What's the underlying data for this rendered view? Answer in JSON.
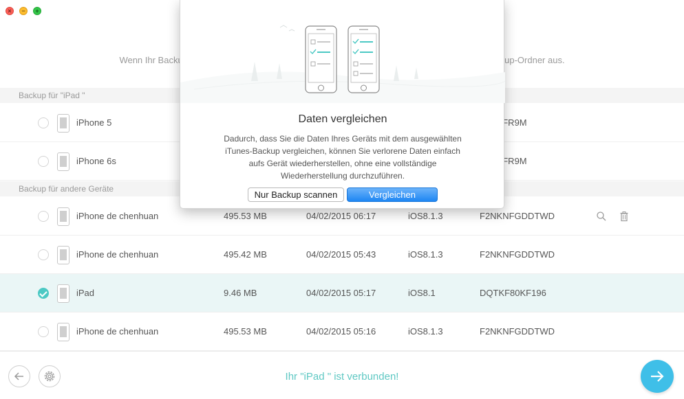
{
  "window": {
    "close_glyph": "×",
    "minimize_glyph": "−",
    "zoom_glyph": "+"
  },
  "header": {
    "title": "B                                         s",
    "subtitle": "Wenn Ihr Backup unten nic                                                                                              einen Backup-Ordner aus."
  },
  "sections": [
    {
      "label": "Backup für \"iPad \"",
      "rows": [
        {
          "name": "iPhone 5",
          "size": "",
          "date": "",
          "ios": "",
          "serial": "2PKPFR9M",
          "selected": false
        },
        {
          "name": "iPhone 6s",
          "size": "",
          "date": "",
          "ios": "",
          "serial": "2PKPFR9M",
          "selected": false
        }
      ]
    },
    {
      "label": "Backup für andere Geräte",
      "rows": [
        {
          "name": "iPhone de chenhuan",
          "size": "495.53 MB",
          "date": "04/02/2015 06:17",
          "ios": "iOS8.1.3",
          "serial": "F2NKNFGDDTWD",
          "selected": false
        },
        {
          "name": "iPhone de chenhuan",
          "size": "495.42 MB",
          "date": "04/02/2015 05:43",
          "ios": "iOS8.1.3",
          "serial": "F2NKNFGDDTWD",
          "selected": false
        },
        {
          "name": "iPad",
          "size": "9.46 MB",
          "date": "04/02/2015 05:17",
          "ios": "iOS8.1",
          "serial": "DQTKF80KF196",
          "selected": true
        },
        {
          "name": "iPhone de chenhuan",
          "size": "495.53 MB",
          "date": "04/02/2015 05:16",
          "ios": "iOS8.1.3",
          "serial": "F2NKNFGDDTWD",
          "selected": false
        }
      ]
    }
  ],
  "row_actions": {
    "search_icon": "search-icon",
    "delete_icon": "trash-icon"
  },
  "footer": {
    "status": "Ihr \"iPad \" ist verbunden!"
  },
  "dialog": {
    "title": "Daten vergleichen",
    "body_lines": [
      "Dadurch, dass Sie die Daten Ihres Geräts mit dem ausgewählten",
      "iTunes-Backup vergleichen, können Sie verlorene Daten einfach",
      "aufs Gerät wiederherstellen, ohne eine vollständige",
      "Wiederherstellung durchzuführen."
    ],
    "scan_button": "Nur Backup scannen",
    "compare_button": "Vergleichen"
  },
  "colors": {
    "accent": "#4cc9c4",
    "primary_button": "#1e86f3",
    "next_button": "#3fbfe8"
  }
}
